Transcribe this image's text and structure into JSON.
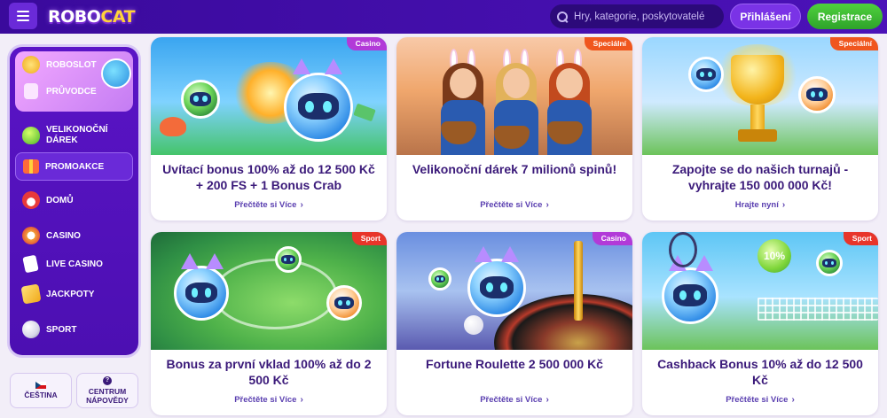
{
  "header": {
    "logo": {
      "part1": "ROBO",
      "part2": "CAT"
    },
    "search_placeholder": "Hry, kategorie, poskytovatelé",
    "login_label": "Přihlášení",
    "register_label": "Registrace"
  },
  "sidebar": {
    "top_items": [
      {
        "label": "ROBOSLOT",
        "icon": "coin-icon"
      },
      {
        "label": "PRŮVODCE",
        "icon": "guide-icon"
      }
    ],
    "items": [
      {
        "label1": "VELIKONOČNÍ",
        "label2": "DÁREK",
        "icon": "easter-egg-icon"
      },
      {
        "label": "PROMOAKCE",
        "icon": "gift-icon",
        "active": true
      },
      {
        "label": "DOMŮ",
        "icon": "home-icon"
      },
      {
        "label": "CASINO",
        "icon": "casino-chip-icon"
      },
      {
        "label": "LIVE CASINO",
        "icon": "cards-icon"
      },
      {
        "label": "JACKPOTY",
        "icon": "jackpot-icon"
      },
      {
        "label": "SPORT",
        "icon": "football-icon"
      }
    ]
  },
  "bottom": {
    "language_label": "ČEŠTINA",
    "help_label1": "CENTRUM",
    "help_label2": "NÁPOVĚDY"
  },
  "cards": [
    {
      "badge": "Casino",
      "title": "Uvítací bonus 100% až do 12 500 Kč + 200 FS + 1 Bonus Crab",
      "link": "Přečtěte si Více"
    },
    {
      "badge": "Speciální",
      "title": "Velikonoční dárek 7 milionů spinů!",
      "link": "Přečtěte si Více"
    },
    {
      "badge": "Speciální",
      "title": "Zapojte se do našich turnajů - vyhrajte 150 000 000 Kč!",
      "link": "Hrajte nyní"
    },
    {
      "badge": "Sport",
      "title": "Bonus za první vklad 100% až do 2 500 Kč",
      "link": "Přečtěte si Více"
    },
    {
      "badge": "Casino",
      "title": "Fortune Roulette 2 500 000 Kč",
      "link": "Přečtěte si Více"
    },
    {
      "badge": "Sport",
      "title": "Cashback Bonus 10% až do 12 500 Kč",
      "link": "Přečtěte si Více"
    }
  ],
  "colors": {
    "header_bg": "#4b12b8",
    "accent_purple": "#7a33e6",
    "register_green": "#3cbf33",
    "badge_casino": "#b23ad8",
    "badge_special": "#f0561e",
    "badge_sport": "#e8352a",
    "card_title": "#3b1a7a"
  },
  "tennis_ball_text": "10%"
}
